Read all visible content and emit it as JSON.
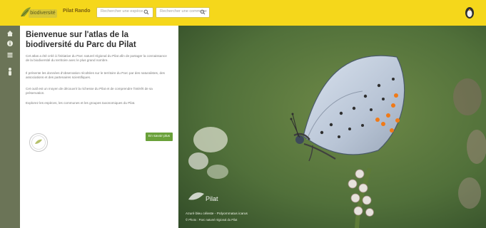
{
  "header": {
    "logo_text": "biodiversité",
    "link": "Pilat Rando",
    "search1_placeholder": "Rechercher une espèce",
    "search2_placeholder": "Rechercher une commune"
  },
  "intro": {
    "title": "Bienvenue sur l'atlas de la biodiversité du Parc du Pilat",
    "paragraphs": [
      "Cet atlas a été créé à l'initiative du Parc naturel régional du Pilat afin de partager la connaissance de la biodiversité du territoire avec le plus grand nombre.",
      "Il présente les données d'observation récoltées sur le territoire du Parc par des naturalistes, des associations et des partenaires scientifiques.",
      "Cet outil est un moyen de découvrir la richesse du Pilat et de comprendre l'intérêt de sa préservation.",
      "Explorez les espèces, les communes et les groupes taxonomiques du Pilat."
    ],
    "button_label": "En savoir plus"
  },
  "photo": {
    "logo_text": "Pilat",
    "caption": "Azuré bleu céleste - Polyommatus icarus",
    "credit": "© Photo : Parc naturel régional du Pilat"
  },
  "colors": {
    "header": "#f5d71b",
    "rail": "#6b7457",
    "button": "#6aa13a"
  },
  "icons": [
    "home-icon",
    "info-icon",
    "list-icon",
    "person-icon",
    "search-icon",
    "user-icon"
  ]
}
